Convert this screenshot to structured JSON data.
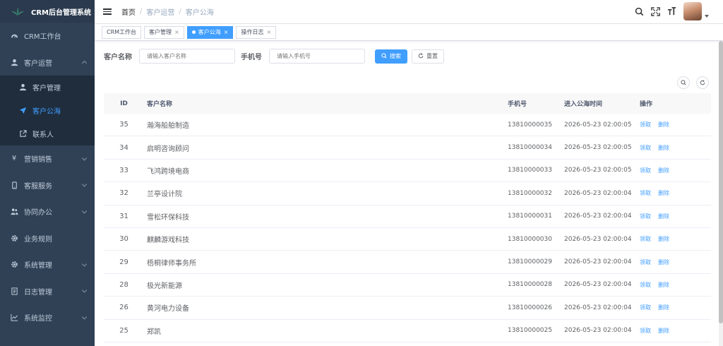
{
  "app": {
    "title": "CRM后台管理系统"
  },
  "sidebar": {
    "items": [
      {
        "label": "CRM工作台",
        "icon": "dashboard-icon"
      },
      {
        "label": "客户运营",
        "icon": "user-icon",
        "expanded": true,
        "children": [
          {
            "label": "客户管理",
            "icon": "user-icon"
          },
          {
            "label": "客户公海",
            "icon": "send-icon",
            "active": true
          },
          {
            "label": "联系人",
            "icon": "external-link-icon"
          }
        ]
      },
      {
        "label": "营销销售",
        "icon": "yen-icon"
      },
      {
        "label": "客服服务",
        "icon": "phone-icon"
      },
      {
        "label": "协同办公",
        "icon": "peoples-icon"
      },
      {
        "label": "业务规则",
        "icon": "gear-icon"
      },
      {
        "label": "系统管理",
        "icon": "gear-icon"
      },
      {
        "label": "日志管理",
        "icon": "log-icon"
      },
      {
        "label": "系统监控",
        "icon": "monitor-icon"
      }
    ]
  },
  "breadcrumb": [
    "首页",
    "客户运营",
    "客户公海"
  ],
  "tags": [
    {
      "label": "CRM工作台",
      "closable": false
    },
    {
      "label": "客户管理",
      "closable": true
    },
    {
      "label": "客户公海",
      "closable": true,
      "active": true
    },
    {
      "label": "操作日志",
      "closable": true
    }
  ],
  "search": {
    "name_label": "客户名称",
    "name_placeholder": "请输入客户名称",
    "phone_label": "手机号",
    "phone_placeholder": "请输入手机号",
    "search_button": "搜索",
    "reset_button": "重置"
  },
  "table": {
    "headers": {
      "id": "ID",
      "name": "客户名称",
      "phone": "手机号",
      "time": "进入公海时间",
      "op": "操作"
    },
    "op_claim": "领取",
    "op_delete": "删除",
    "rows": [
      {
        "id": "35",
        "name": "瀚海船舶制造",
        "phone": "13810000035",
        "time": "2026-05-23 02:00:05"
      },
      {
        "id": "34",
        "name": "启明咨询顾问",
        "phone": "13810000034",
        "time": "2026-05-23 02:00:05"
      },
      {
        "id": "33",
        "name": "飞鸿跨境电商",
        "phone": "13810000033",
        "time": "2026-05-23 02:00:05"
      },
      {
        "id": "32",
        "name": "兰亭设计院",
        "phone": "13810000032",
        "time": "2026-05-23 02:00:04"
      },
      {
        "id": "31",
        "name": "雪松环保科技",
        "phone": "13810000031",
        "time": "2026-05-23 02:00:04"
      },
      {
        "id": "30",
        "name": "麒麟游戏科技",
        "phone": "13810000030",
        "time": "2026-05-23 02:00:04"
      },
      {
        "id": "29",
        "name": "梧桐律师事务所",
        "phone": "13810000029",
        "time": "2026-05-23 02:00:04"
      },
      {
        "id": "28",
        "name": "极光新能源",
        "phone": "13810000028",
        "time": "2026-05-23 02:00:04"
      },
      {
        "id": "26",
        "name": "黄河电力设备",
        "phone": "13810000026",
        "time": "2026-05-23 02:00:04"
      },
      {
        "id": "25",
        "name": "郑凯",
        "phone": "13810000025",
        "time": "2026-05-23 02:00:04"
      }
    ]
  },
  "colors": {
    "sidebar_bg": "#304156",
    "submenu_bg": "#1f2d3d",
    "accent": "#409eff"
  }
}
